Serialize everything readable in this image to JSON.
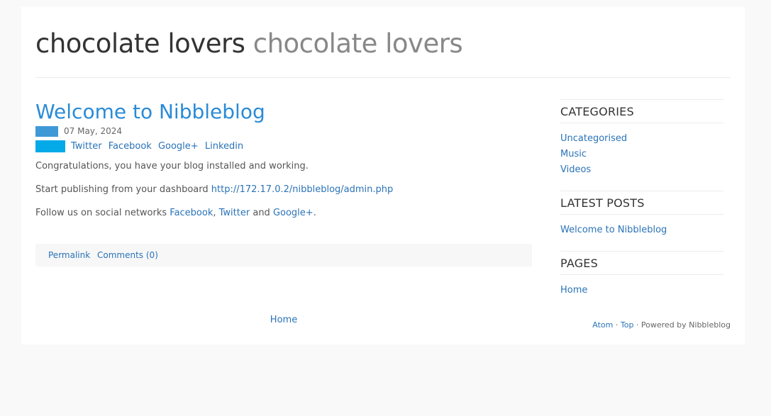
{
  "site": {
    "name": "chocolate lovers",
    "slogan": "chocolate lovers"
  },
  "post": {
    "title": "Welcome to Nibbleblog",
    "date": "07 May, 2024",
    "share": [
      "Twitter",
      "Facebook",
      "Google+",
      "Linkedin"
    ],
    "para1": "Congratulations, you have your blog installed and working.",
    "para2_text": "Start publishing from your dashboard ",
    "para2_link": "http://172.17.0.2/nibbleblog/admin.php",
    "para3_text": "Follow us on social networks ",
    "para3_link1": "Facebook",
    "para3_sep": ", ",
    "para3_link2": "Twitter",
    "para3_and": " and ",
    "para3_link3": "Google+",
    "para3_end": ".",
    "permalink": "Permalink",
    "comments": "Comments (0)"
  },
  "pager": {
    "home": "Home"
  },
  "sidebar": {
    "categories": {
      "title": "CATEGORIES",
      "items": [
        "Uncategorised",
        "Music",
        "Videos"
      ]
    },
    "latest": {
      "title": "LATEST POSTS",
      "items": [
        "Welcome to Nibbleblog"
      ]
    },
    "pages": {
      "title": "PAGES",
      "items": [
        "Home"
      ]
    }
  },
  "footer": {
    "atom": "Atom",
    "sep1": " · ",
    "top": "Top",
    "powered": " · Powered by Nibbleblog"
  },
  "colors": {
    "link": "#2a73b8",
    "post_title": "#2a8bd6",
    "date_chip": "#3f99d6",
    "share_chip": "#04a9e8",
    "page_bg": "#f9f9f9"
  }
}
